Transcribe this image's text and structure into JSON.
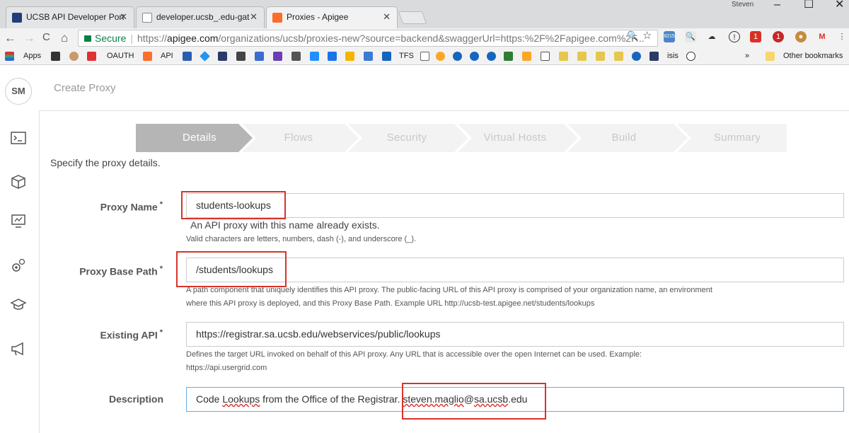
{
  "browser": {
    "tabs": [
      {
        "label": "UCSB API Developer Port",
        "favicon_color": "#1f3f7a",
        "active": false
      },
      {
        "label": "developer.ucsb_.edu-gat",
        "favicon_color": "#ffffff",
        "active": false
      },
      {
        "label": "Proxies - Apigee",
        "favicon_color": "#fb6e2c",
        "active": true
      }
    ],
    "user": "Steven",
    "window_controls": {
      "minimize": "–",
      "maximize": "☐",
      "close": "✕"
    },
    "nav": {
      "back": "←",
      "forward": "→",
      "reload": "C",
      "home": "⌂"
    },
    "address": {
      "secure_label": "Secure",
      "scheme": "https://",
      "host": "apigee.com",
      "path": "/organizations/ucsb/proxies-new?source=backend&swaggerUrl=https:%2F%2Fapigee.com%2F..."
    },
    "bookmarks": [
      "Apps",
      "OAUTH",
      "API",
      "TFS",
      "isis",
      "»",
      "Other bookmarks"
    ],
    "extension_badges": {
      "ext1": "8215",
      "gmail": "1",
      "abp": "1"
    }
  },
  "app": {
    "avatar_initials": "SM",
    "page_title": "Create Proxy",
    "sidebar_icons": [
      "terminal-icon",
      "cube-icon",
      "monitor-icon",
      "gears-icon",
      "graduation-cap-icon",
      "megaphone-icon"
    ]
  },
  "wizard": {
    "steps": [
      "Details",
      "Flows",
      "Security",
      "Virtual Hosts",
      "Build",
      "Summary"
    ],
    "active_index": 0
  },
  "form": {
    "intro": "Specify the proxy details.",
    "required_marker": "*",
    "proxy_name": {
      "label": "Proxy Name",
      "value": "students-lookups",
      "error": "An API proxy with this name already exists.",
      "help": "Valid characters are letters, numbers, dash (-), and underscore (_)."
    },
    "proxy_base_path": {
      "label": "Proxy Base Path",
      "value": "/students/lookups",
      "help_line1": "A path component that uniquely identifies this API proxy. The public-facing URL of this API proxy is comprised of your organization name, an environment",
      "help_line2": "where this API proxy is deployed, and this Proxy Base Path. Example URL http://ucsb-test.apigee.net/students/lookups"
    },
    "existing_api": {
      "label": "Existing API",
      "value": "https://registrar.sa.ucsb.edu/webservices/public/lookups",
      "help_line1": "Defines the target URL invoked on behalf of this API proxy. Any URL that is accessible over the open Internet can be used. Example:",
      "help_line2": "https://api.usergrid.com"
    },
    "description": {
      "label": "Description",
      "value_part1": "Code ",
      "value_part2": "Lookups",
      "value_part3": " from the Office of the Registrar. ",
      "value_part4": "steven.maglio",
      "value_part5": "@",
      "value_part6": "sa.ucsb",
      "value_part7": ".edu"
    }
  },
  "colors": {
    "highlight": "#d9332a",
    "secure": "#0b8043",
    "apigee_orange": "#fb6e2c",
    "step_active": "#b5b5b5"
  }
}
